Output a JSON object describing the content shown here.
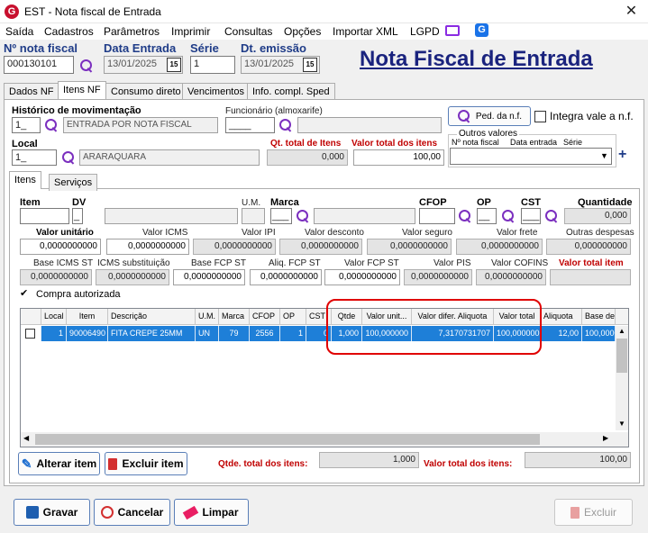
{
  "window": {
    "title": "EST - Nota fiscal de Entrada",
    "close": "✕"
  },
  "menu": [
    "Saída",
    "Cadastros",
    "Parâmetros",
    "Imprimir",
    "Consultas",
    "Opções",
    "Importar XML",
    "LGPD"
  ],
  "header": {
    "nf_label": "Nº nota fiscal",
    "nf_value": "000130101",
    "data_entrada_label": "Data Entrada",
    "data_entrada_value": "13/01/2025",
    "serie_label": "Série",
    "serie_value": "1",
    "dt_emissao_label": "Dt. emissão",
    "dt_emissao_value": "13/01/2025",
    "big_title": "Nota Fiscal de Entrada",
    "cal_glyph": "15"
  },
  "main_tabs": [
    "Dados NF",
    "Itens NF",
    "Consumo direto",
    "Vencimentos",
    "Info. compl. Sped"
  ],
  "itens_nf": {
    "historico_label": "Histórico de movimentação",
    "historico_code": "1_",
    "historico_desc": "ENTRADA POR NOTA FISCAL",
    "funcionario_label": "Funcionário (almoxarife)",
    "funcionario_code": "____",
    "ped_button": "Ped. da n.f.",
    "integra_label": "Integra vale a n.f.",
    "local_label": "Local",
    "local_code": "1_",
    "local_desc": "ARARAQUARA",
    "qt_total_label": "Qt. total de Itens",
    "qt_total_value": "0,000",
    "valor_total_label": "Valor total dos itens",
    "valor_total_value": "100,00",
    "outros_valores_label": "Outros valores",
    "outros_col1": "Nº nota fiscal",
    "outros_col2": "Data entrada",
    "outros_col3": "Série",
    "plus": "+"
  },
  "sub_tabs": [
    "Itens",
    "Serviços"
  ],
  "item_form": {
    "item_label": "Item",
    "dv_label": "DV",
    "um_label": "U.M.",
    "marca_label": "Marca",
    "cfop_label": "CFOP",
    "op_label": "OP",
    "cst_label": "CST",
    "quantidade_label": "Quantidade",
    "dv_value": "_",
    "marca_value": "___",
    "op_value": "__",
    "cst_value": "___",
    "quantidade_value": "0,000",
    "row2": [
      {
        "label": "Valor unitário",
        "value": "0,0000000000"
      },
      {
        "label": "Valor ICMS",
        "value": "0,0000000000"
      },
      {
        "label": "Valor IPI",
        "value": "0,0000000000"
      },
      {
        "label": "Valor desconto",
        "value": "0,0000000000"
      },
      {
        "label": "Valor seguro",
        "value": "0,0000000000"
      },
      {
        "label": "Valor frete",
        "value": "0,0000000000"
      },
      {
        "label": "Outras despesas",
        "value": "0,000000000"
      }
    ],
    "row3": [
      {
        "label": "Base ICMS ST",
        "value": "0,0000000000"
      },
      {
        "label": "ICMS substituição",
        "value": "0,0000000000"
      },
      {
        "label": "Base FCP ST",
        "value": "0,0000000000"
      },
      {
        "label": "Aliq. FCP ST",
        "value": "0,0000000000"
      },
      {
        "label": "Valor FCP ST",
        "value": "0,0000000000"
      },
      {
        "label": "Valor PIS",
        "value": "0,0000000000"
      },
      {
        "label": "Valor COFINS",
        "value": "0,0000000000"
      },
      {
        "label": "Valor total item",
        "value": ""
      }
    ],
    "compra_autorizada": "Compra autorizada"
  },
  "grid": {
    "headers": [
      "",
      "Local",
      "Item",
      "Descrição",
      "U.M.",
      "Marca",
      "CFOP",
      "OP",
      "CST",
      "Qtde",
      "Valor unit...",
      "Valor difer. Aliquota",
      "Valor total",
      "Aliquota",
      "Base de"
    ],
    "row": [
      "",
      "1",
      "90006490",
      "FITA CREPE 25MM",
      "UN",
      "79",
      "2556",
      "1",
      "0",
      "1,000",
      "100,000000",
      "7,3170731707",
      "100,000000",
      "12,00",
      "100,0000"
    ]
  },
  "footer_item": {
    "alterar": "Alterar item",
    "excluir": "Excluir item",
    "qtde_total_label": "Qtde. total dos itens:",
    "qtde_total_value": "1,000",
    "valor_total_label": "Valor total dos itens:",
    "valor_total_value": "100,00"
  },
  "bottom_buttons": {
    "gravar": "Gravar",
    "cancelar": "Cancelar",
    "limpar": "Limpar",
    "excluir": "Excluir"
  },
  "colors": {
    "accent": "#1f3c88",
    "highlight": "#1e7fd8",
    "red_label": "#c00000",
    "annotation": "#e00000"
  }
}
